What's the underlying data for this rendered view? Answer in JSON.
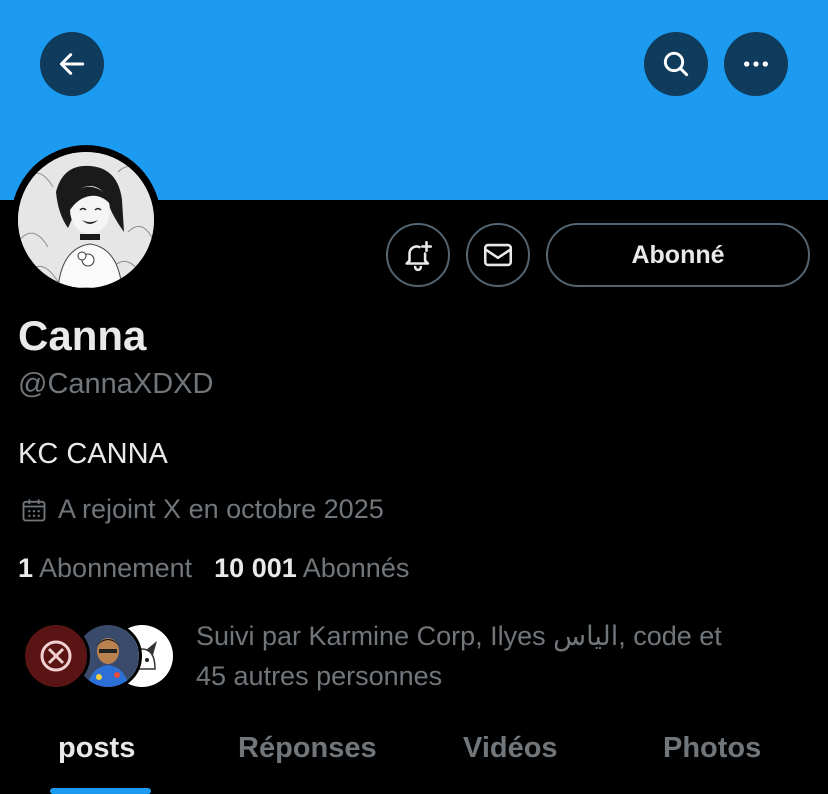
{
  "header": {
    "back_icon": "arrow-left-icon",
    "search_icon": "search-icon",
    "more_icon": "more-horizontal-icon",
    "banner_color": "#1d9bf0"
  },
  "profile": {
    "avatar_icon": "manga-avatar",
    "display_name": "Canna",
    "handle": "@CannaXDXD",
    "bio": "KC CANNA",
    "joined": "A rejoint X en octobre 2025",
    "following_count": "1",
    "following_label": "Abonnement",
    "followers_count": "10 001",
    "followers_label": "Abonnés"
  },
  "actions": {
    "notify_icon": "bell-plus-icon",
    "message_icon": "envelope-icon",
    "follow_label": "Abonné"
  },
  "followed_by": {
    "line1": "Suivi par Karmine Corp, Ilyes الياس, code et",
    "line2": "45 autres personnes"
  },
  "tabs": [
    {
      "label": "posts",
      "active": true
    },
    {
      "label": "Réponses",
      "active": false
    },
    {
      "label": "Vidéos",
      "active": false
    },
    {
      "label": "Photos",
      "active": false
    }
  ],
  "colors": {
    "accent": "#1d9bf0",
    "background": "#000000",
    "secondary_text": "#71767b",
    "primary_text": "#e7e9ea"
  }
}
